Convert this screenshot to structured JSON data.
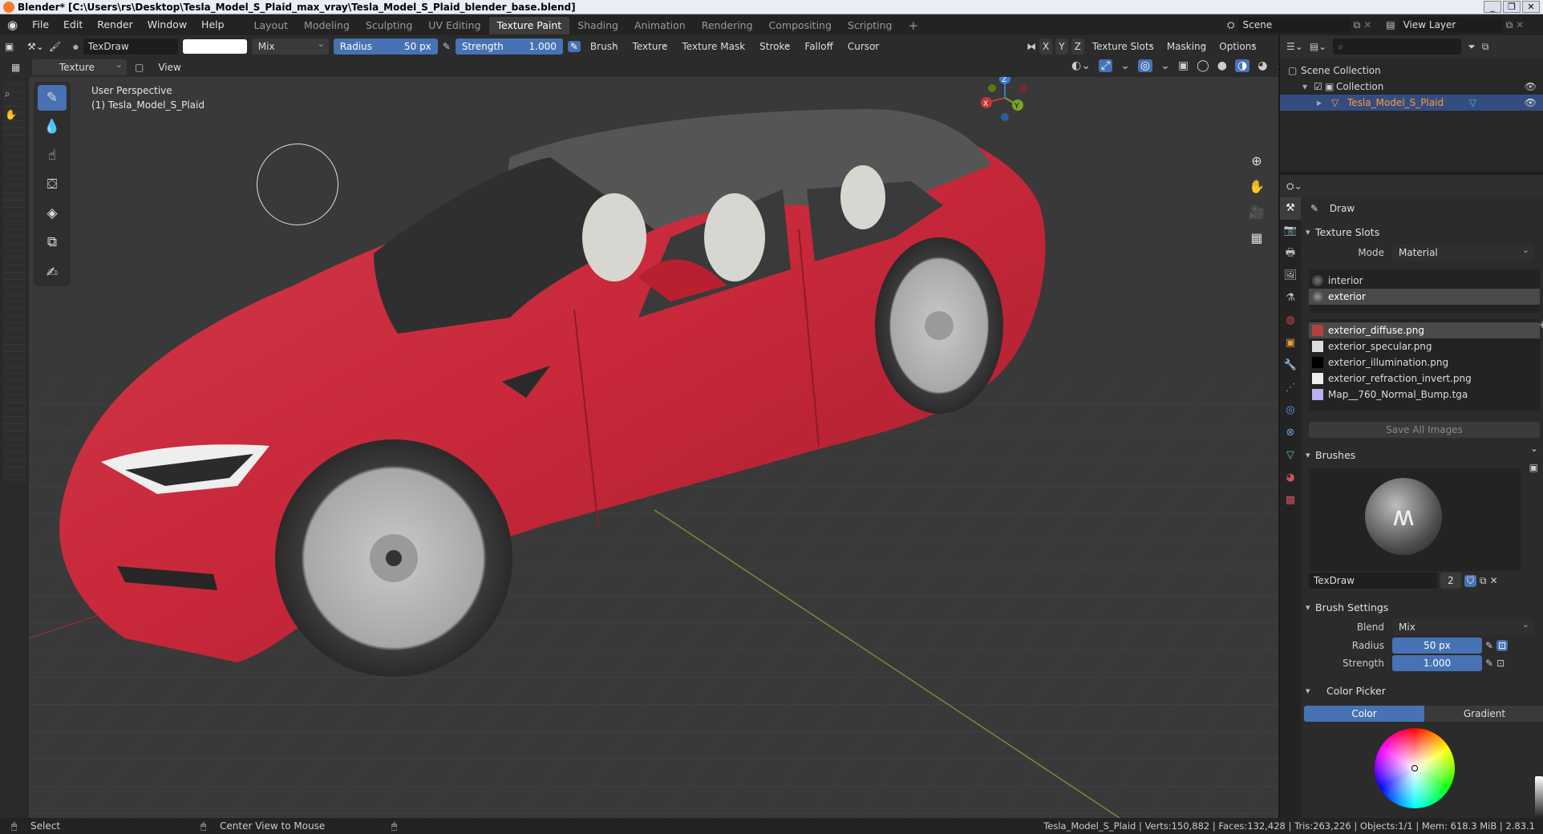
{
  "window": {
    "title": "Blender* [C:\\Users\\rs\\Desktop\\Tesla_Model_S_Plaid_max_vray\\Tesla_Model_S_Plaid_blender_base.blend]",
    "controls": [
      "_",
      "❐",
      "✕"
    ]
  },
  "menu": [
    "File",
    "Edit",
    "Render",
    "Window",
    "Help"
  ],
  "workspaces": [
    {
      "label": "Layout",
      "active": false
    },
    {
      "label": "Modeling",
      "active": false
    },
    {
      "label": "Sculpting",
      "active": false
    },
    {
      "label": "UV Editing",
      "active": false
    },
    {
      "label": "Texture Paint",
      "active": true
    },
    {
      "label": "Shading",
      "active": false
    },
    {
      "label": "Animation",
      "active": false
    },
    {
      "label": "Rendering",
      "active": false
    },
    {
      "label": "Compositing",
      "active": false
    },
    {
      "label": "Scripting",
      "active": false
    }
  ],
  "add_workspace": "+",
  "scene": {
    "label": "Scene",
    "view_layer": "View Layer"
  },
  "toolheader": {
    "brush_name": "TexDraw",
    "blend": "Mix",
    "radius_label": "Radius",
    "radius_value": "50 px",
    "strength_label": "Strength",
    "strength_value": "1.000",
    "menus": [
      "Brush",
      "Texture",
      "Texture Mask",
      "Stroke",
      "Falloff",
      "Cursor"
    ],
    "axes": [
      "X",
      "Y",
      "Z"
    ],
    "right_menus": [
      "Texture Slots",
      "Masking",
      "Options"
    ]
  },
  "header2": {
    "mode": "Texture Paint",
    "view": "View"
  },
  "viewport": {
    "perspective": "User Perspective",
    "object": "(1) Tesla_Model_S_Plaid",
    "gizmo": {
      "x": "X",
      "y": "Y",
      "z": "Z"
    },
    "colors": {
      "body": "#c7283a",
      "bg": "#393939",
      "grid": "#444444",
      "x_axis": "#9c3a3a",
      "y_axis": "#6f8f3a"
    }
  },
  "outliner": {
    "scene_collection": "Scene Collection",
    "collection": "Collection",
    "object": "Tesla_Model_S_Plaid"
  },
  "properties": {
    "tool": "Draw",
    "texture_slots": {
      "title": "Texture Slots",
      "mode_label": "Mode",
      "mode_value": "Material",
      "materials": [
        "interior",
        "exterior"
      ],
      "selected_material": "exterior",
      "images": [
        {
          "name": "exterior_diffuse.png",
          "color": "#b44040"
        },
        {
          "name": "exterior_specular.png",
          "color": "#dddddd"
        },
        {
          "name": "exterior_illumination.png",
          "color": "#000000"
        },
        {
          "name": "exterior_refraction_invert.png",
          "color": "#eeeeee"
        },
        {
          "name": "Map__760_Normal_Bump.tga",
          "color": "#b8b0f0"
        }
      ],
      "save_all": "Save All Images"
    },
    "brushes": {
      "title": "Brushes",
      "name": "TexDraw",
      "users": "2"
    },
    "brush_settings": {
      "title": "Brush Settings",
      "blend_label": "Blend",
      "blend_value": "Mix",
      "radius_label": "Radius",
      "radius_value": "50 px",
      "strength_label": "Strength",
      "strength_value": "1.000"
    },
    "color_picker": {
      "title": "Color Picker",
      "tabs": [
        "Color",
        "Gradient"
      ],
      "active_tab": "Color"
    }
  },
  "statusbar": {
    "select": "Select",
    "center": "Center View to Mouse",
    "stats": "Tesla_Model_S_Plaid | Verts:150,882 | Faces:132,428 | Tris:263,226 | Objects:1/1 | Mem: 618.3 MiB | 2.83.1"
  }
}
